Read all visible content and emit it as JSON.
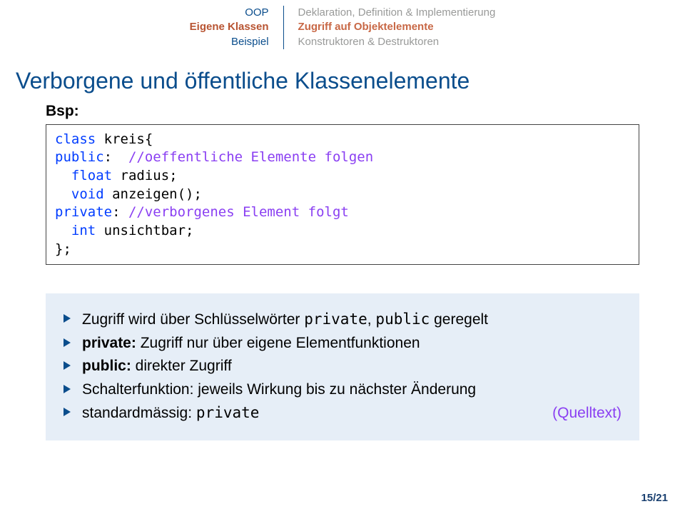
{
  "nav": {
    "left": [
      "OOP",
      "Eigene Klassen",
      "Beispiel"
    ],
    "left_active_index": 1,
    "right": [
      "Deklaration, Definition & Implementierung",
      "Zugriff auf Objektelemente",
      "Konstruktoren & Destruktoren"
    ],
    "right_active_index": 1
  },
  "title": "Verborgene und öffentliche Klassenelemente",
  "bsp_label": "Bsp:",
  "code": {
    "l1a": "class",
    "l1b": " kreis{",
    "l2a": "public",
    "l2b": ":  ",
    "l2c": "//oeffentliche Elemente folgen",
    "l3a": "  ",
    "l3b": "float",
    "l3c": " radius;",
    "l4a": "  ",
    "l4b": "void",
    "l4c": " anzeigen();",
    "l5a": "private",
    "l5b": ": ",
    "l5c": "//verborgenes Element folgt",
    "l6a": "  ",
    "l6b": "int",
    "l6c": " unsichtbar;",
    "l7": "};"
  },
  "bullets": {
    "b1a": "Zugriff wird über Schlüsselwörter ",
    "b1b": "private",
    "b1c": ", ",
    "b1d": "public",
    "b1e": " geregelt",
    "b2a": "private:",
    "b2b": " Zugriff nur über eigene Elementfunktionen",
    "b3a": "public:",
    "b3b": " direkter Zugriff",
    "b4": "Schalterfunktion: jeweils Wirkung bis zu nächster Änderung",
    "b5a": "standardmässig: ",
    "b5b": "private",
    "b5_link": "(Quelltext)"
  },
  "page": "15/21"
}
